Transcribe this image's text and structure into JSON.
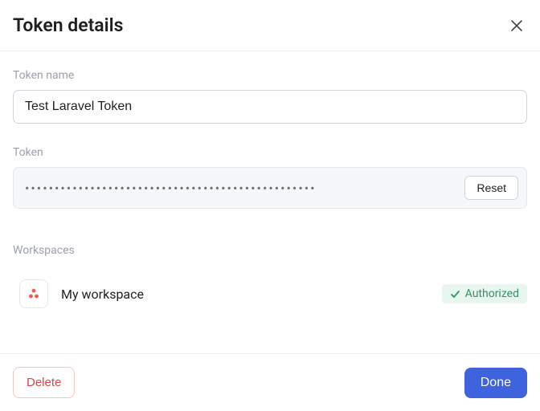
{
  "header": {
    "title": "Token details"
  },
  "fields": {
    "token_name_label": "Token name",
    "token_name_value": "Test Laravel Token",
    "token_label": "Token",
    "token_value": "•••••••••••••••••••••••••••••••••••••••••••••••••",
    "reset_label": "Reset"
  },
  "workspaces": {
    "label": "Workspaces",
    "items": [
      {
        "name": "My workspace",
        "status": "Authorized"
      }
    ]
  },
  "footer": {
    "delete_label": "Delete",
    "done_label": "Done"
  }
}
